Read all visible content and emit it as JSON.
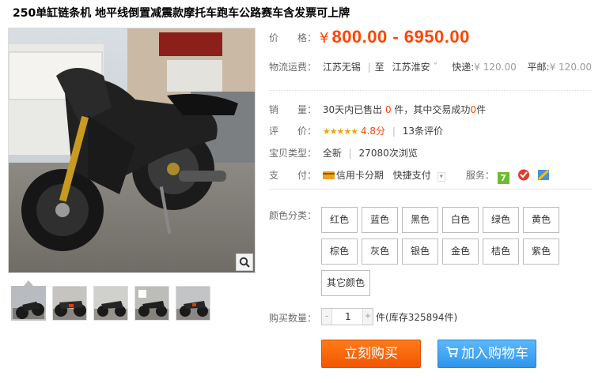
{
  "title": "250单缸链条机 地平线倒置减震款摩托车跑车公路赛车含发票可上牌",
  "price": {
    "label": "价　　格：",
    "currency": "¥",
    "value": "800.00 - 6950.00"
  },
  "logistics": {
    "label": "物流运费：",
    "from": "江苏无锡",
    "to_prefix": "至",
    "to": "江苏淮安",
    "express_label": "快递:",
    "express_price": "¥ 120.00",
    "surface_label": "平邮:",
    "surface_price": "¥ 120.00"
  },
  "sales": {
    "label": "销　　量：",
    "text_a": "30天内已售出",
    "sold": "0",
    "text_b": "件，其中交易成功",
    "success": "0",
    "text_c": "件"
  },
  "rating": {
    "label": "评　　价：",
    "stars": "★★★★★",
    "score": "4.8分",
    "reviews": "13条评价"
  },
  "item_type": {
    "label": "宝贝类型：",
    "value": "全新",
    "views": "27080次浏览"
  },
  "payment": {
    "label": "支　　付：",
    "credit": "信用卡分期",
    "quick": "快捷支付",
    "service_label": "服务：",
    "service_days": "7"
  },
  "color": {
    "label": "颜色分类：",
    "options": [
      "红色",
      "蓝色",
      "黑色",
      "白色",
      "绿色",
      "黄色",
      "棕色",
      "灰色",
      "银色",
      "金色",
      "桔色",
      "紫色",
      "其它颜色"
    ]
  },
  "quantity": {
    "label": "购买数量：",
    "value": "1",
    "unit": "件",
    "stock": "(库存325894件)"
  },
  "buttons": {
    "buy_now": "立刻购买",
    "add_cart": "加入购物车"
  },
  "colors": {
    "accent": "#ff4400",
    "buy": "#f35500",
    "cart": "#2e95ea"
  }
}
